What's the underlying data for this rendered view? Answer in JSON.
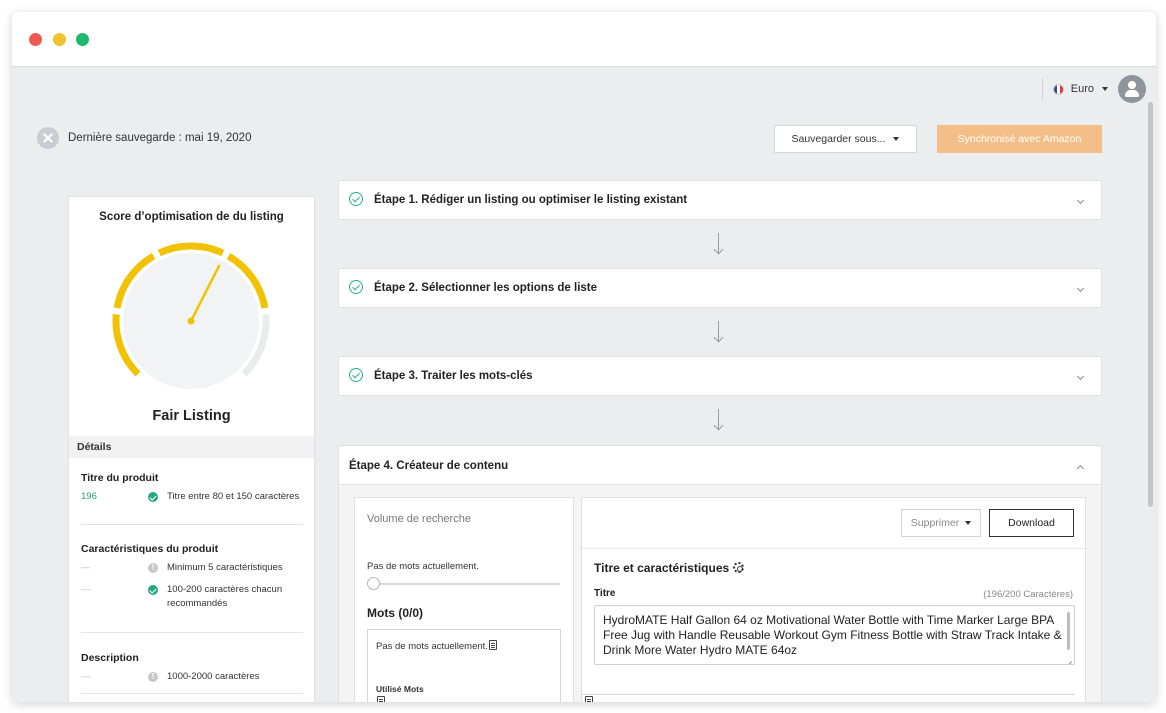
{
  "topbar": {
    "currency": "Euro"
  },
  "savebar": {
    "last_saved": "Dernière sauvegarde : mai 19, 2020",
    "save_as": "Sauvegarder sous...",
    "sync": "Synchronisé avec Amazon"
  },
  "score": {
    "title": "Score d’optimisation de du listing",
    "label": "Fair Listing",
    "level_fraction": 0.6,
    "details_header": "Détails",
    "sections": {
      "title": {
        "heading": "Titre du produit",
        "value": "196",
        "criterion": "Titre entre 80 et 150 caractères"
      },
      "features": {
        "heading": "Caractéristiques du produit",
        "value1": "—",
        "criterion1": "Minimum 5 caractéristiques",
        "value2": "—",
        "criterion2": "100-200 caractères chacun recommandés"
      },
      "description": {
        "heading": "Description",
        "value": "—",
        "criterion": "1000-2000 caractères"
      }
    },
    "colors": {
      "gauge_active": "#f2c200",
      "gauge_inactive": "#e9ebec",
      "ok": "#26a784"
    }
  },
  "steps": [
    {
      "label": "Étape 1. Rédiger un listing ou optimiser le listing existant"
    },
    {
      "label": "Étape 2. Sélectionner les options de liste"
    },
    {
      "label": "Étape 3. Traiter les mots-clés"
    },
    {
      "label": "Étape 4. Créateur de contenu"
    }
  ],
  "keywords": {
    "volume_label": "Volume de recherche",
    "no_words": "Pas de mots actuellement.",
    "words_heading": "Mots (0/0)",
    "box_text": "Pas de mots actuellement.",
    "used_label": "Utilisé Mots"
  },
  "content": {
    "delete_label": "Supprimer",
    "download_label": "Download",
    "section_title": "Titre et caractéristiques",
    "field_label": "Titre",
    "char_count": "(196/200 Caractères)",
    "title_value": "HydroMATE Half Gallon 64 oz Motivational Water Bottle with Time Marker Large BPA Free Jug with Handle Reusable Workout Gym Fitness Bottle with Straw Track Intake & Drink More Water Hydro MATE 64oz"
  },
  "icons": [
    "close-icon",
    "flag-icon",
    "user-icon",
    "check-icon",
    "info-icon",
    "chevron-down-icon",
    "chevron-up-icon",
    "arrow-down-icon",
    "copy-icon",
    "gear-icon"
  ]
}
